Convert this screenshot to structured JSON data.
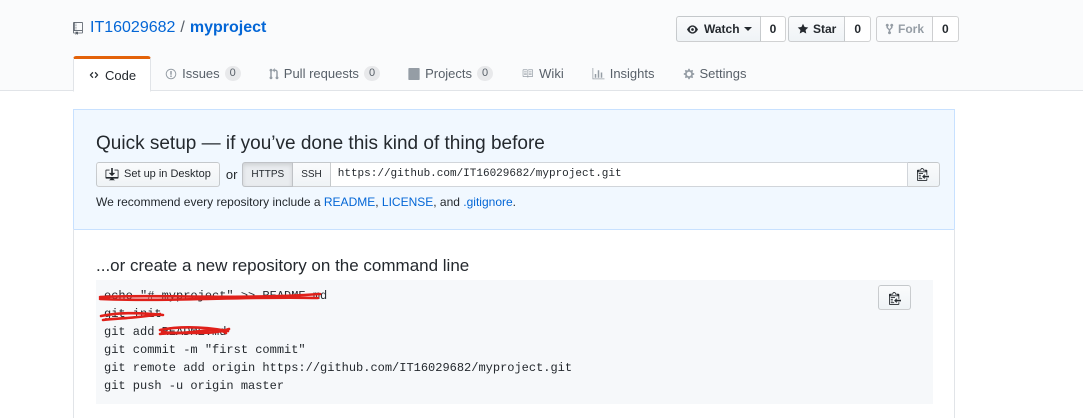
{
  "repo": {
    "owner": "IT16029682",
    "separator": "/",
    "name": "myproject"
  },
  "actions": {
    "watch": {
      "label": "Watch",
      "count": "0"
    },
    "star": {
      "label": "Star",
      "count": "0"
    },
    "fork": {
      "label": "Fork",
      "count": "0"
    }
  },
  "tabs": [
    {
      "label": "Code",
      "icon": "code-icon",
      "selected": true
    },
    {
      "label": "Issues",
      "icon": "issue-icon",
      "counter": "0"
    },
    {
      "label": "Pull requests",
      "icon": "pull-request-icon",
      "counter": "0"
    },
    {
      "label": "Projects",
      "icon": "project-icon",
      "counter": "0"
    },
    {
      "label": "Wiki",
      "icon": "book-icon"
    },
    {
      "label": "Insights",
      "icon": "graph-icon"
    },
    {
      "label": "Settings",
      "icon": "gear-icon"
    }
  ],
  "quick_setup": {
    "title": "Quick setup — if you’ve done this kind of thing before",
    "desktop_button": "Set up in Desktop",
    "or": "or",
    "https": "HTTPS",
    "ssh": "SSH",
    "url": "https://github.com/IT16029682/myproject.git",
    "recommend_prefix": "We recommend every repository include a ",
    "readme": "README",
    "comma": ", ",
    "license": "LICENSE",
    "and": ", and ",
    "gitignore": ".gitignore",
    "period": "."
  },
  "command_line": {
    "title": "...or create a new repository on the command line",
    "lines": [
      "echo \"# myproject\" >> README.md",
      "git init",
      "git add README.md",
      "git commit -m \"first commit\"",
      "git remote add origin https://github.com/IT16029682/myproject.git",
      "git push -u origin master"
    ]
  },
  "colors": {
    "link": "#0366d6",
    "tab_accent": "#e36209",
    "annotation": "#e0201a"
  }
}
